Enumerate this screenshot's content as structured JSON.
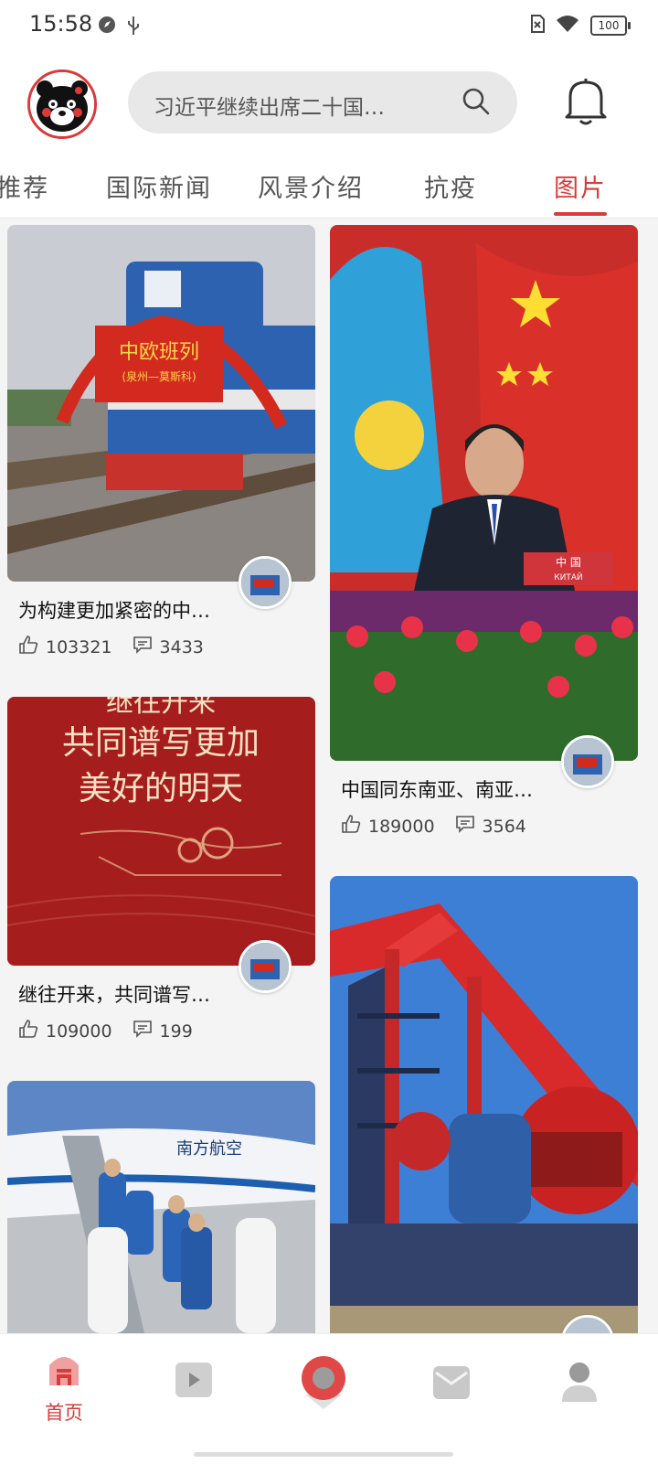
{
  "status_bar": {
    "time": "15:58",
    "battery": "100"
  },
  "header": {
    "search_placeholder": "习近平继续出席二十国…"
  },
  "tabs": [
    {
      "label": "推荐"
    },
    {
      "label": "国际新闻"
    },
    {
      "label": "风景介绍"
    },
    {
      "label": "抗疫"
    },
    {
      "label": "图片"
    }
  ],
  "cards": [
    {
      "title": "为构建更加紧密的中…",
      "likes": "103321",
      "comments": "3433",
      "image_caption": "中欧班列",
      "image_sub": "(泉州—莫斯科)"
    },
    {
      "title": "中国同东南亚、南亚…",
      "likes": "189000",
      "comments": "3564",
      "image_caption": "中 国",
      "image_sub": "КИТАЙ"
    },
    {
      "title": "继往开来，共同谱写…",
      "likes": "109000",
      "comments": "199",
      "image_line1": "继往开来",
      "image_line2": "共同谱写更加",
      "image_line3": "美好的明天"
    },
    {
      "image_caption": "南方航空"
    },
    {}
  ],
  "bottom_nav": [
    {
      "label": "首页"
    }
  ]
}
